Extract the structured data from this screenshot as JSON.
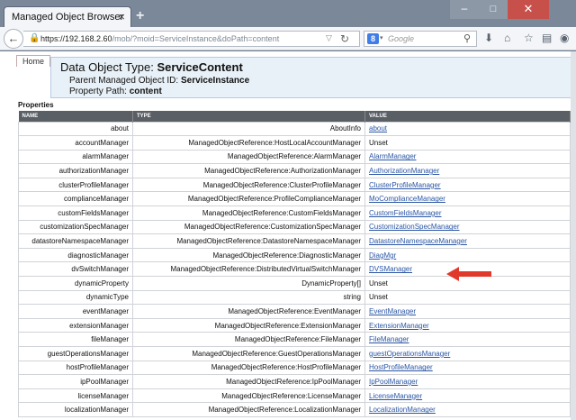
{
  "browser": {
    "tab_title": "Managed Object Browser",
    "tab_close": "×",
    "new_tab": "+",
    "url_host": "https://192.168.2.60",
    "url_path": "/mob/?moid=ServiceInstance&doPath=content",
    "search_engine_letter": "8",
    "search_placeholder": "Google"
  },
  "window_controls": {
    "minimize": "–",
    "maximize": "□",
    "close": "✕"
  },
  "page": {
    "home_label": "Home",
    "title_prefix": "Data Object Type: ",
    "title_type": "ServiceContent",
    "parent_prefix": "Parent Managed Object ID: ",
    "parent_id": "ServiceInstance",
    "path_prefix": "Property Path: ",
    "path_value": "content",
    "properties_label": "Properties"
  },
  "table": {
    "headers": [
      "NAME",
      "TYPE",
      "VALUE"
    ],
    "rows": [
      {
        "name": "about",
        "type": "AboutInfo",
        "value": "about",
        "link": true
      },
      {
        "name": "accountManager",
        "type": "ManagedObjectReference:HostLocalAccountManager",
        "value": "Unset",
        "link": false
      },
      {
        "name": "alarmManager",
        "type": "ManagedObjectReference:AlarmManager",
        "value": "AlarmManager",
        "link": true
      },
      {
        "name": "authorizationManager",
        "type": "ManagedObjectReference:AuthorizationManager",
        "value": "AuthorizationManager",
        "link": true
      },
      {
        "name": "clusterProfileManager",
        "type": "ManagedObjectReference:ClusterProfileManager",
        "value": "ClusterProfileManager",
        "link": true
      },
      {
        "name": "complianceManager",
        "type": "ManagedObjectReference:ProfileComplianceManager",
        "value": "MoComplianceManager",
        "link": true
      },
      {
        "name": "customFieldsManager",
        "type": "ManagedObjectReference:CustomFieldsManager",
        "value": "CustomFieldsManager",
        "link": true
      },
      {
        "name": "customizationSpecManager",
        "type": "ManagedObjectReference:CustomizationSpecManager",
        "value": "CustomizationSpecManager",
        "link": true
      },
      {
        "name": "datastoreNamespaceManager",
        "type": "ManagedObjectReference:DatastoreNamespaceManager",
        "value": "DatastoreNamespaceManager",
        "link": true
      },
      {
        "name": "diagnosticManager",
        "type": "ManagedObjectReference:DiagnosticManager",
        "value": "DiagMgr",
        "link": true
      },
      {
        "name": "dvSwitchManager",
        "type": "ManagedObjectReference:DistributedVirtualSwitchManager",
        "value": "DVSManager",
        "link": true
      },
      {
        "name": "dynamicProperty",
        "type": "DynamicProperty[]",
        "value": "Unset",
        "link": false
      },
      {
        "name": "dynamicType",
        "type": "string",
        "value": "Unset",
        "link": false
      },
      {
        "name": "eventManager",
        "type": "ManagedObjectReference:EventManager",
        "value": "EventManager",
        "link": true
      },
      {
        "name": "extensionManager",
        "type": "ManagedObjectReference:ExtensionManager",
        "value": "ExtensionManager",
        "link": true
      },
      {
        "name": "fileManager",
        "type": "ManagedObjectReference:FileManager",
        "value": "FileManager",
        "link": true
      },
      {
        "name": "guestOperationsManager",
        "type": "ManagedObjectReference:GuestOperationsManager",
        "value": "guestOperationsManager",
        "link": true
      },
      {
        "name": "hostProfileManager",
        "type": "ManagedObjectReference:HostProfileManager",
        "value": "HostProfileManager",
        "link": true
      },
      {
        "name": "ipPoolManager",
        "type": "ManagedObjectReference:IpPoolManager",
        "value": "IpPoolManager",
        "link": true
      },
      {
        "name": "licenseManager",
        "type": "ManagedObjectReference:LicenseManager",
        "value": "LicenseManager",
        "link": true
      },
      {
        "name": "localizationManager",
        "type": "ManagedObjectReference:LocalizationManager",
        "value": "LocalizationManager",
        "link": true
      }
    ]
  },
  "colors": {
    "link": "#2a56a5",
    "header_bg": "#5a5f66",
    "annotation_arrow": "#e0392b"
  }
}
